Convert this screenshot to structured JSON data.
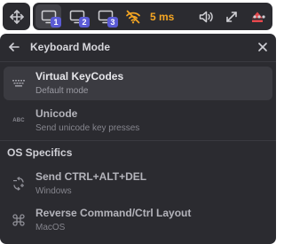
{
  "toolbar": {
    "monitors": [
      {
        "number": "1",
        "active": true
      },
      {
        "number": "2",
        "active": false
      },
      {
        "number": "3",
        "active": false
      }
    ],
    "latency": "5 ms",
    "icons": [
      "move-icon",
      "monitor-icon",
      "wifi-off-icon",
      "volume-icon",
      "expand-icon",
      "eject-icon",
      "more-icon"
    ],
    "colors": {
      "background": "#2b2b30",
      "badge": "#5b5bd6",
      "latency": "#f5a623",
      "eject": "#e5484d"
    }
  },
  "panel": {
    "title": "Keyboard Mode",
    "items": [
      {
        "title": "Virtual KeyCodes",
        "subtitle": "Default mode",
        "icon": "keyboard-icon",
        "selected": true
      },
      {
        "title": "Unicode",
        "subtitle": "Send unicode key presses",
        "icon": "abc-icon",
        "icon_text": "ABC",
        "selected": false
      }
    ],
    "section": {
      "label": "OS Specifics",
      "items": [
        {
          "title": "Send CTRL+ALT+DEL",
          "subtitle": "Windows",
          "icon": "windows-keys-icon"
        },
        {
          "title": "Reverse Command/Ctrl Layout",
          "subtitle": "MacOS",
          "icon": "command-icon"
        }
      ]
    }
  }
}
